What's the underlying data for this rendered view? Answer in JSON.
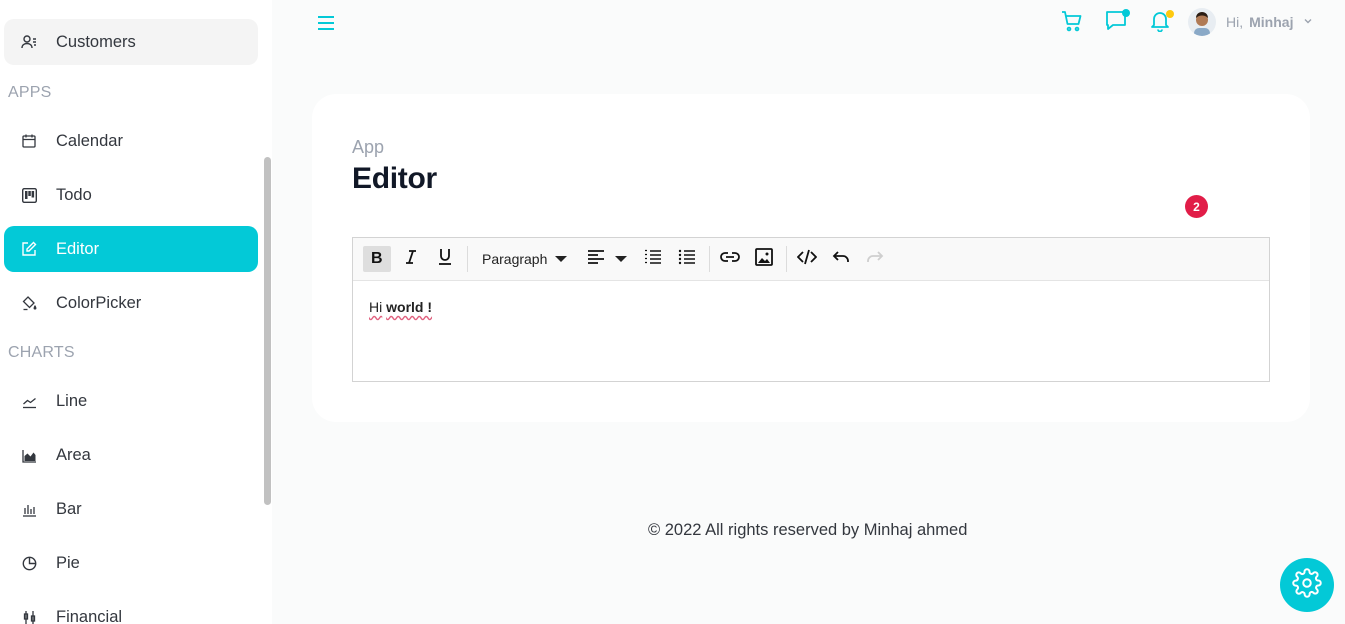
{
  "sidebar": {
    "items": [
      {
        "label": "Customers",
        "icon": "customers-icon"
      },
      {
        "label": "Calendar",
        "icon": "calendar-icon"
      },
      {
        "label": "Todo",
        "icon": "kanban-icon"
      },
      {
        "label": "Editor",
        "icon": "edit-icon"
      },
      {
        "label": "ColorPicker",
        "icon": "color-fill-icon"
      },
      {
        "label": "Line",
        "icon": "line-chart-icon"
      },
      {
        "label": "Area",
        "icon": "area-chart-icon"
      },
      {
        "label": "Bar",
        "icon": "bar-chart-icon"
      },
      {
        "label": "Pie",
        "icon": "pie-chart-icon"
      },
      {
        "label": "Financial",
        "icon": "financial-chart-icon"
      }
    ],
    "sections": {
      "apps": "APPS",
      "charts": "CHARTS"
    },
    "active": "Editor"
  },
  "header": {
    "greeting": "Hi,",
    "username": "Minhaj",
    "notification_dot_colors": {
      "chat": "#03c9d7",
      "bell": "#fec90f"
    }
  },
  "page": {
    "breadcrumb": "App",
    "title": "Editor"
  },
  "editor": {
    "format_dropdown": "Paragraph",
    "content_plain": "Hi",
    "content_bold": "world !",
    "badge_count": "2"
  },
  "footer": {
    "text": "© 2022 All rights reserved by Minhaj ahmed"
  },
  "colors": {
    "accent": "#03c9d7",
    "badge": "#e11d48"
  }
}
